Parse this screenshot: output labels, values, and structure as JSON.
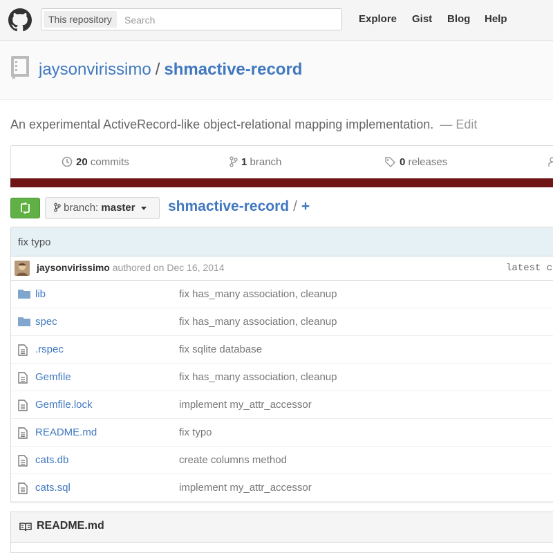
{
  "header": {
    "logo_icon": "github-octocat-icon",
    "search_scope": "This repository",
    "search_placeholder": "Search",
    "nav": [
      "Explore",
      "Gist",
      "Blog",
      "Help"
    ]
  },
  "repo": {
    "owner": "jaysonvirissimo",
    "separator": "/",
    "name": "shmactive-record",
    "description": "An experimental ActiveRecord-like object-relational mapping implementation.",
    "edit_label": "— Edit"
  },
  "summary": {
    "commits_count": "20",
    "commits_label": "commits",
    "branch_count": "1",
    "branch_label": "branch",
    "releases_count": "0",
    "releases_label": "releases",
    "language_color": "#701516"
  },
  "toolbar": {
    "branch_prefix": "branch:",
    "branch_name": "master",
    "breadcrumb_repo": "shmactive-record",
    "breadcrumb_sep": "/",
    "breadcrumb_add": "+"
  },
  "last_commit": {
    "message": "fix typo",
    "author": "jaysonvirissimo",
    "authored_text": "authored on Dec 16, 2014",
    "latest_text": "latest c"
  },
  "files": [
    {
      "type": "dir",
      "name": "lib",
      "message": "fix has_many association, cleanup"
    },
    {
      "type": "dir",
      "name": "spec",
      "message": "fix has_many association, cleanup"
    },
    {
      "type": "file",
      "name": ".rspec",
      "message": "fix sqlite database"
    },
    {
      "type": "file",
      "name": "Gemfile",
      "message": "fix has_many association, cleanup"
    },
    {
      "type": "file",
      "name": "Gemfile.lock",
      "message": "implement my_attr_accessor"
    },
    {
      "type": "file",
      "name": "README.md",
      "message": "fix typo"
    },
    {
      "type": "file",
      "name": "cats.db",
      "message": "create columns method"
    },
    {
      "type": "file",
      "name": "cats.sql",
      "message": "implement my_attr_accessor"
    }
  ],
  "readme": {
    "title": "README.md"
  }
}
